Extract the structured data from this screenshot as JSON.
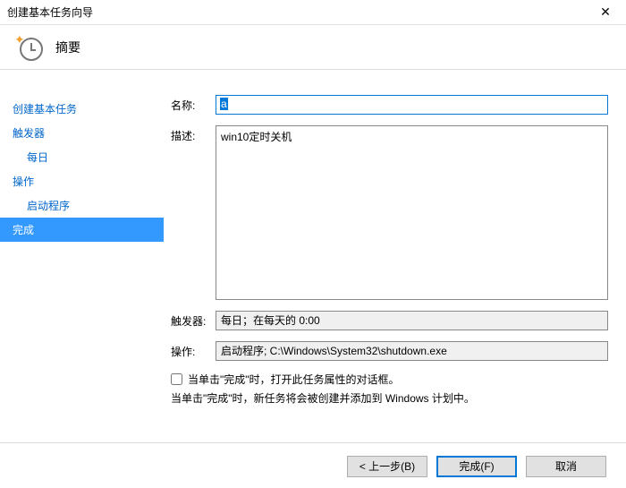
{
  "window": {
    "title": "创建基本任务向导",
    "close": "✕"
  },
  "header": {
    "title": "摘要"
  },
  "sidebar": {
    "items": [
      {
        "label": "创建基本任务",
        "indent": false,
        "selected": false
      },
      {
        "label": "触发器",
        "indent": false,
        "selected": false
      },
      {
        "label": "每日",
        "indent": true,
        "selected": false
      },
      {
        "label": "操作",
        "indent": false,
        "selected": false
      },
      {
        "label": "启动程序",
        "indent": true,
        "selected": false
      },
      {
        "label": "完成",
        "indent": false,
        "selected": true
      }
    ]
  },
  "form": {
    "name_label": "名称:",
    "name_value": "a",
    "desc_label": "描述:",
    "desc_value": "win10定时关机",
    "trigger_label": "触发器:",
    "trigger_value": "每日；在每天的 0:00",
    "action_label": "操作:",
    "action_value": "启动程序; C:\\Windows\\System32\\shutdown.exe",
    "checkbox_label": "当单击\"完成\"时，打开此任务属性的对话框。",
    "hint": "当单击\"完成\"时，新任务将会被创建并添加到 Windows 计划中。"
  },
  "footer": {
    "back": "< 上一步(B)",
    "finish": "完成(F)",
    "cancel": "取消"
  }
}
